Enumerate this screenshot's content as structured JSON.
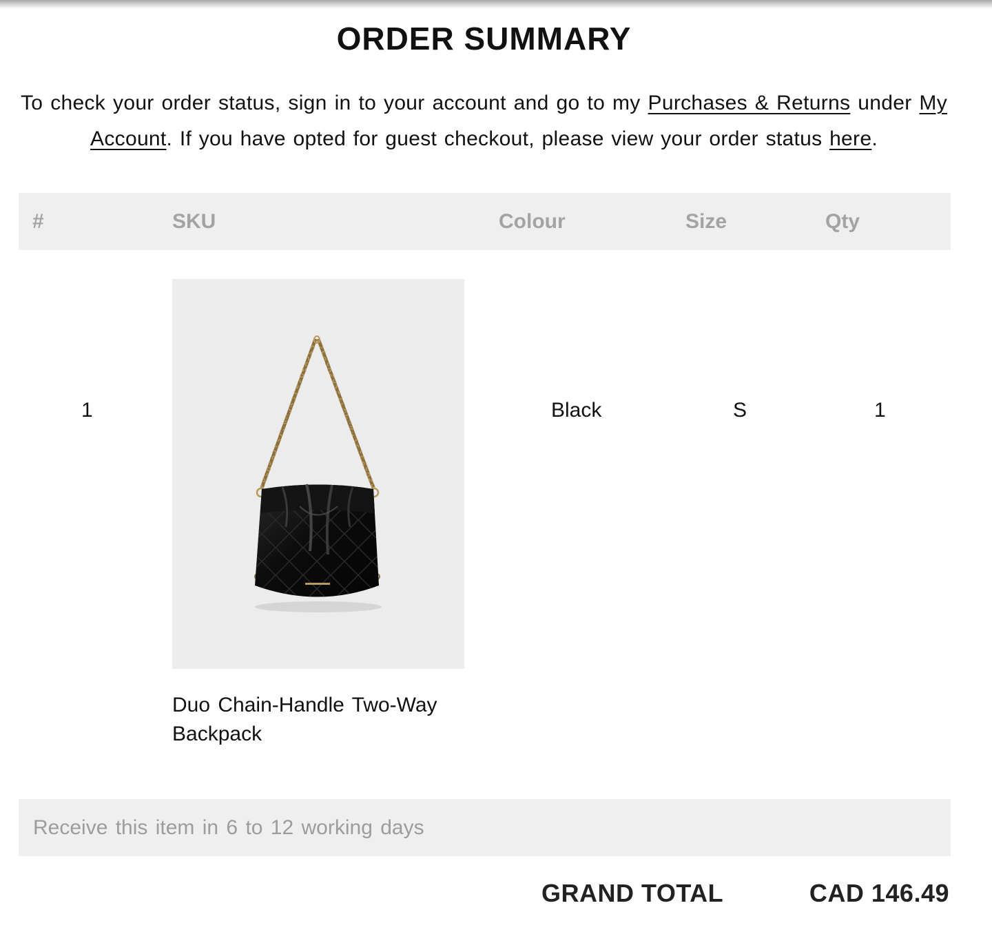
{
  "title": "ORDER SUMMARY",
  "intro": {
    "text_1": "To check your order status, sign in to your account and go to my ",
    "link_purchases": "Purchases & Returns",
    "text_2": " under ",
    "link_account": "My Account",
    "text_3": ". If you have opted for guest checkout, please view your order status ",
    "link_here": "here",
    "text_4": "."
  },
  "table": {
    "headers": {
      "index": "#",
      "sku": "SKU",
      "colour": "Colour",
      "size": "Size",
      "qty": "Qty"
    },
    "rows": [
      {
        "index": "1",
        "name": "Duo Chain-Handle Two-Way Backpack",
        "image_icon": "black-quilted-bucket-bag-image",
        "colour": "Black",
        "size": "S",
        "qty": "1"
      }
    ]
  },
  "delivery": "Receive this item in 6 to 12 working days",
  "grand_total": {
    "label": "GRAND TOTAL",
    "value": "CAD 146.49"
  },
  "colors": {
    "header_bg": "#efefef",
    "header_text": "#a3a3a3",
    "image_bg": "#ececec",
    "text": "#111111"
  }
}
